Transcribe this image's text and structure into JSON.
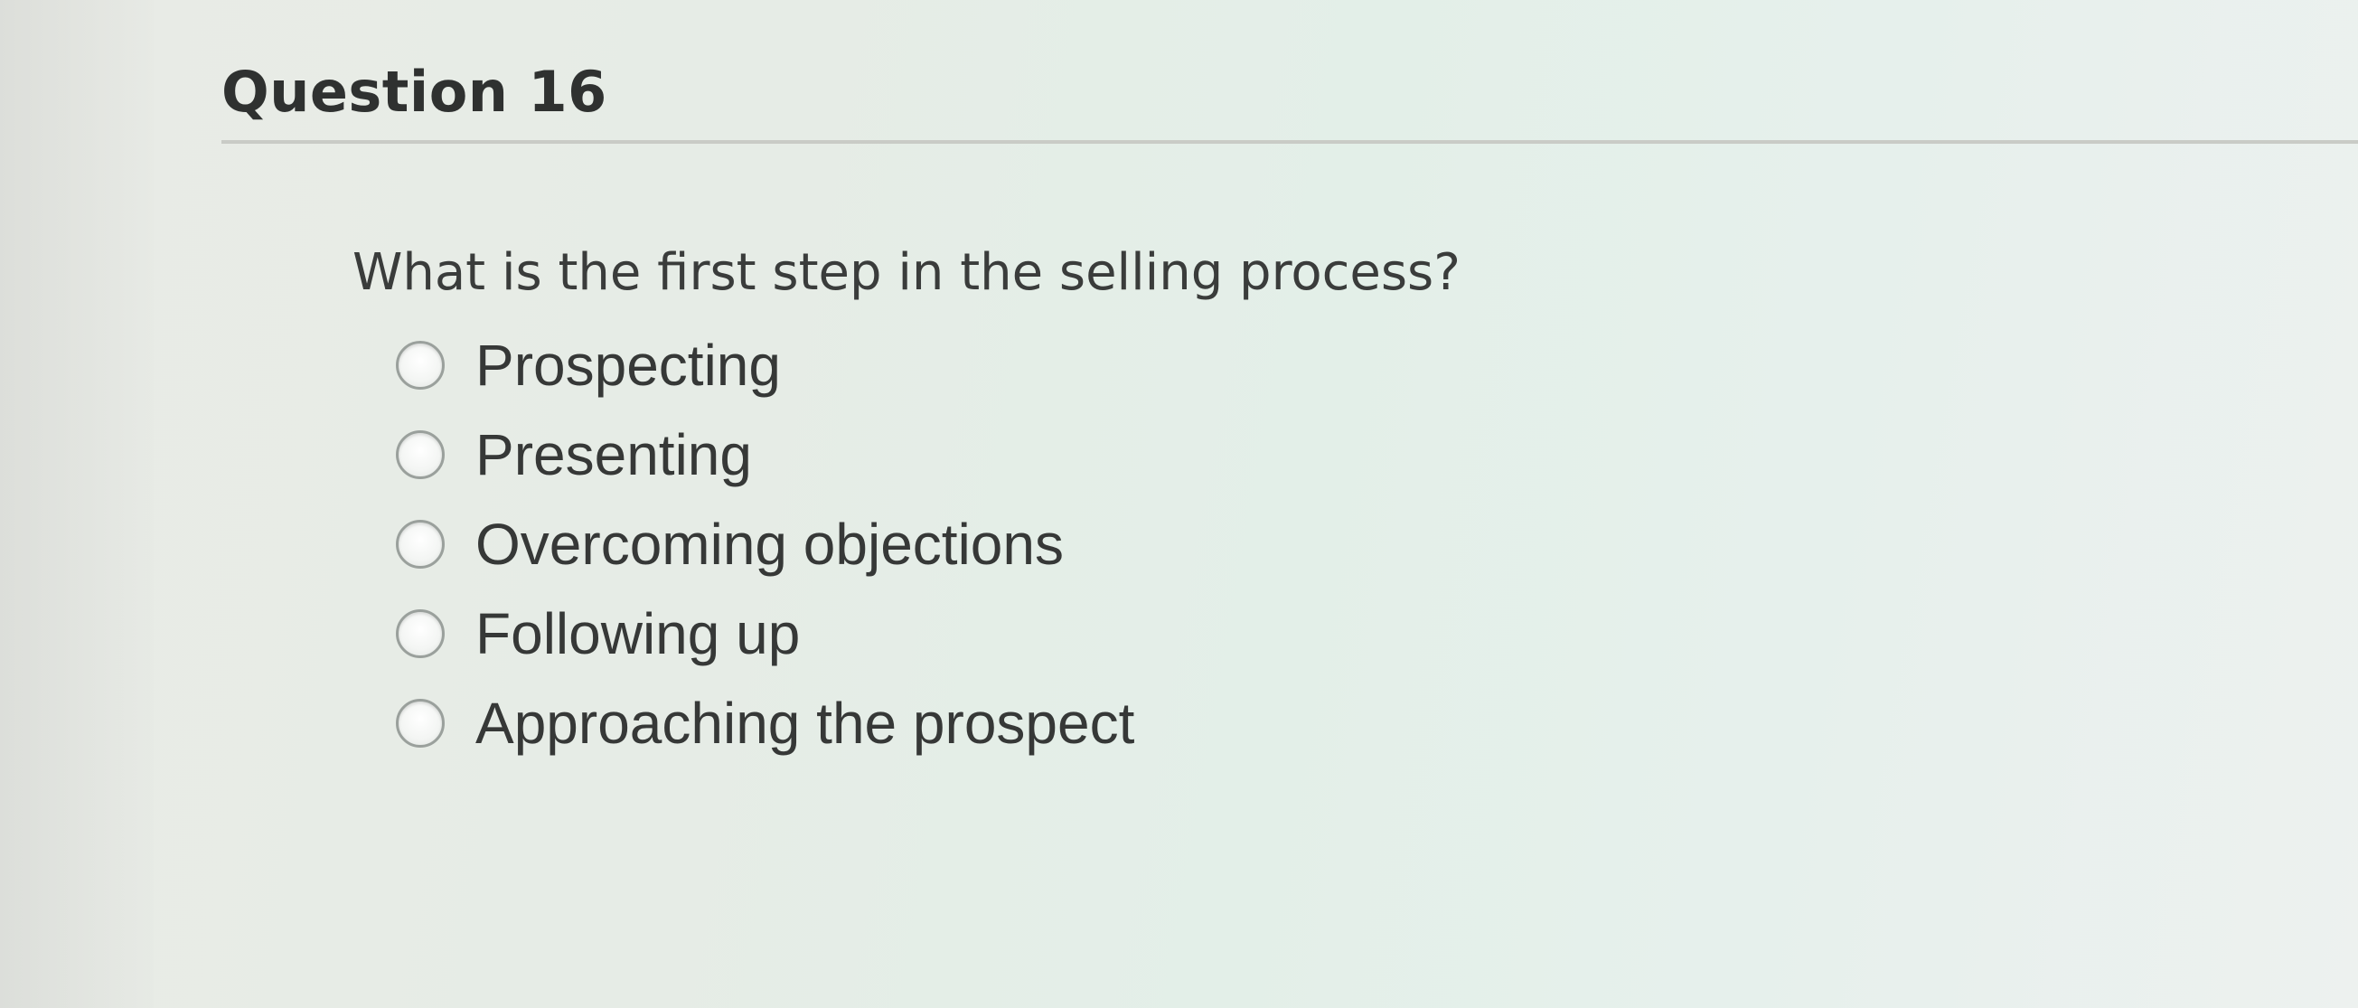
{
  "question": {
    "title": "Question 16",
    "prompt": "What is the first step in the selling process?",
    "options": [
      {
        "label": "Prospecting",
        "selected": false
      },
      {
        "label": "Presenting",
        "selected": false
      },
      {
        "label": "Overcoming objections",
        "selected": false
      },
      {
        "label": "Following up",
        "selected": false
      },
      {
        "label": "Approaching the prospect",
        "selected": false
      }
    ]
  },
  "colors": {
    "text": "#363837",
    "divider": "#c9cbc6",
    "radio_border": "#9aa09c"
  }
}
